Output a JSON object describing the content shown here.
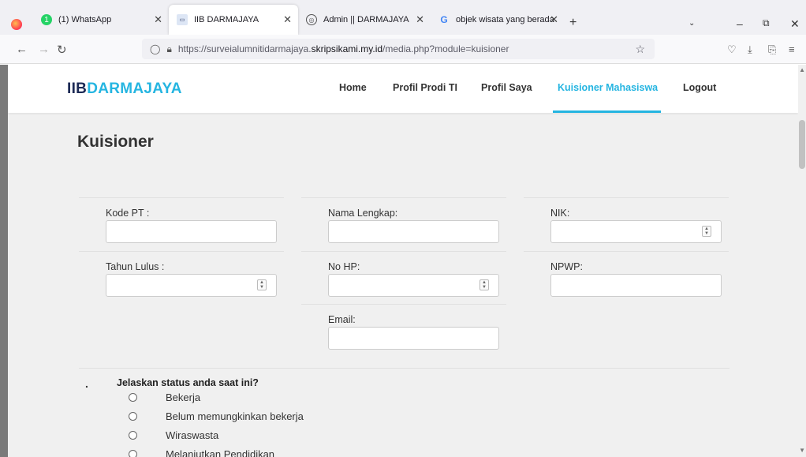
{
  "browser": {
    "tabs": [
      {
        "title": "(1) WhatsApp",
        "active": false
      },
      {
        "title": "IIB DARMAJAYA",
        "active": true
      },
      {
        "title": "Admin || DARMAJAYA",
        "active": false
      },
      {
        "title": "objek wisata yang berada di dar",
        "active": false
      }
    ],
    "url_prefix": "https://surveialumnitidarmajaya.",
    "url_domain": "skripsikami.my.id",
    "url_path": "/media.php?module=kuisioner"
  },
  "site": {
    "brand_part1": "IIB",
    "brand_part2": "DARMAJAYA",
    "menu": [
      "Home",
      "Profil Prodi TI",
      "Profil Saya",
      "Kuisioner Mahasiswa",
      "Logout"
    ],
    "active_menu": "Kuisioner Mahasiswa"
  },
  "page": {
    "title": "Kuisioner",
    "fields": {
      "kode_pt": "Kode PT :",
      "nama_lengkap": "Nama Lengkap:",
      "nik": "NIK:",
      "tahun_lulus": "Tahun Lulus :",
      "no_hp": "No HP:",
      "npwp": "NPWP:",
      "email": "Email:"
    },
    "question": {
      "number": ".",
      "text": "Jelaskan status anda saat ini?",
      "options": [
        "Bekerja",
        "Belum memungkinkan bekerja",
        "Wiraswasta",
        "Melanjutkan Pendidikan"
      ]
    }
  },
  "colors": {
    "accent": "#25b5e1",
    "brand_dark": "#1c2a55",
    "page_bg": "#f0f0f0"
  }
}
